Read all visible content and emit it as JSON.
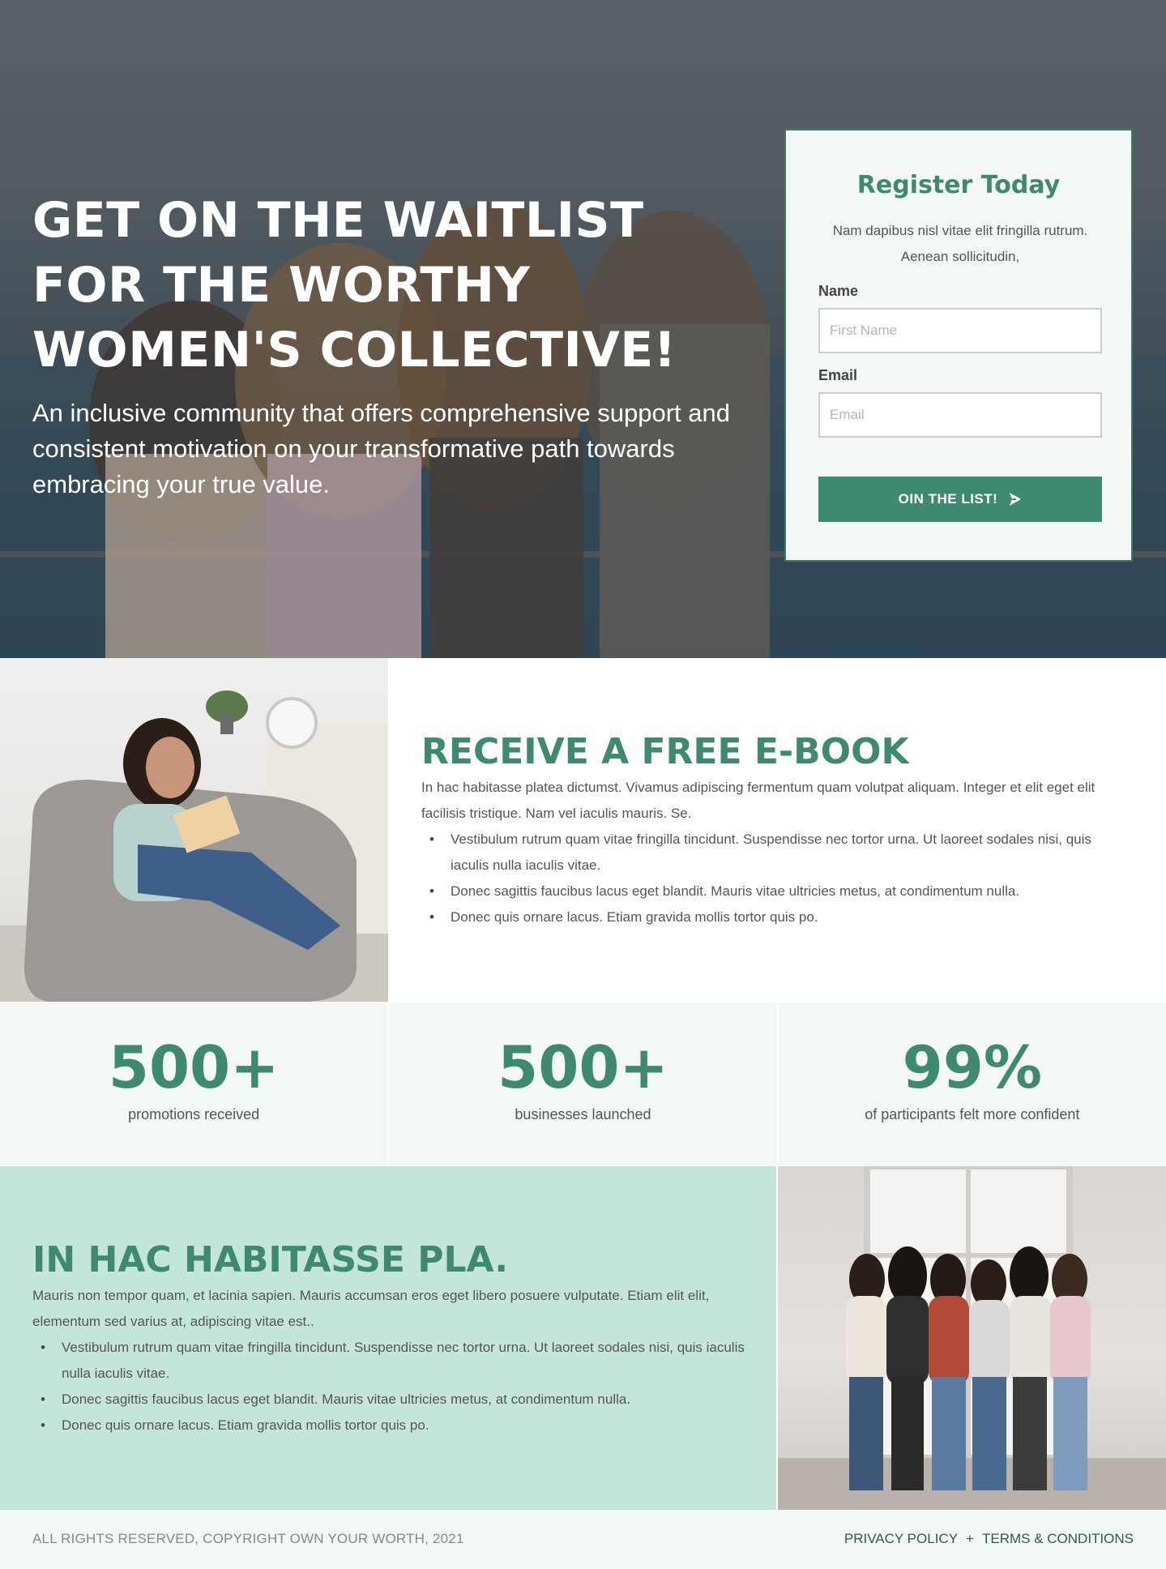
{
  "hero": {
    "title": "GET ON THE WAITLIST FOR THE WORTHY WOMEN'S COLLECTIVE!",
    "subtitle": "An inclusive community that offers comprehensive support and consistent motivation on your transformative path towards embracing your true value."
  },
  "register": {
    "title": "Register Today",
    "description": "Nam dapibus nisl vitae elit fringilla rutrum. Aenean sollicitudin,",
    "name_label": "Name",
    "name_placeholder": "First Name",
    "email_label": "Email",
    "email_placeholder": "Email",
    "button_label": "OIN THE LIST!",
    "button_icon": "send-icon"
  },
  "ebook": {
    "title": "RECEIVE A FREE E-BOOK",
    "body": "In hac habitasse platea dictumst. Vivamus adipiscing fermentum quam volutpat aliquam. Integer et elit eget elit facilisis tristique. Nam vel iaculis mauris. Se.",
    "items": [
      "Vestibulum rutrum quam vitae fringilla tincidunt. Suspendisse nec tortor urna. Ut laoreet sodales nisi, quis iaculis nulla iaculis vitae.",
      "Donec sagittis faucibus lacus eget blandit. Mauris vitae ultricies metus, at condimentum nulla.",
      "Donec quis ornare lacus. Etiam gravida mollis tortor quis po."
    ]
  },
  "stats": [
    {
      "number": "500+",
      "label": "promotions received"
    },
    {
      "number": "500+",
      "label": "businesses launched"
    },
    {
      "number": "99%",
      "label": "of participants felt more confident"
    }
  ],
  "habitasse": {
    "title": "IN HAC HABITASSE PLA.",
    "body": "Mauris non tempor quam, et lacinia sapien. Mauris accumsan eros eget libero posuere vulputate. Etiam elit elit, elementum sed varius at, adipiscing vitae est..",
    "items": [
      "Vestibulum rutrum quam vitae fringilla tincidunt. Suspendisse nec tortor urna. Ut laoreet sodales nisi, quis iaculis nulla iaculis vitae.",
      "Donec sagittis faucibus lacus eget blandit. Mauris vitae ultricies metus, at condimentum nulla.",
      "Donec quis ornare lacus. Etiam gravida mollis tortor quis po."
    ]
  },
  "footer": {
    "copyright": "ALL RIGHTS RESERVED, COPYRIGHT OWN YOUR WORTH, 2021",
    "privacy": "PRIVACY POLICY",
    "separator": "+",
    "terms": "TERMS & CONDITIONS"
  },
  "colors": {
    "accent": "#3d8a6e",
    "mint": "#c4e5dc",
    "light": "#f3f8f6"
  }
}
